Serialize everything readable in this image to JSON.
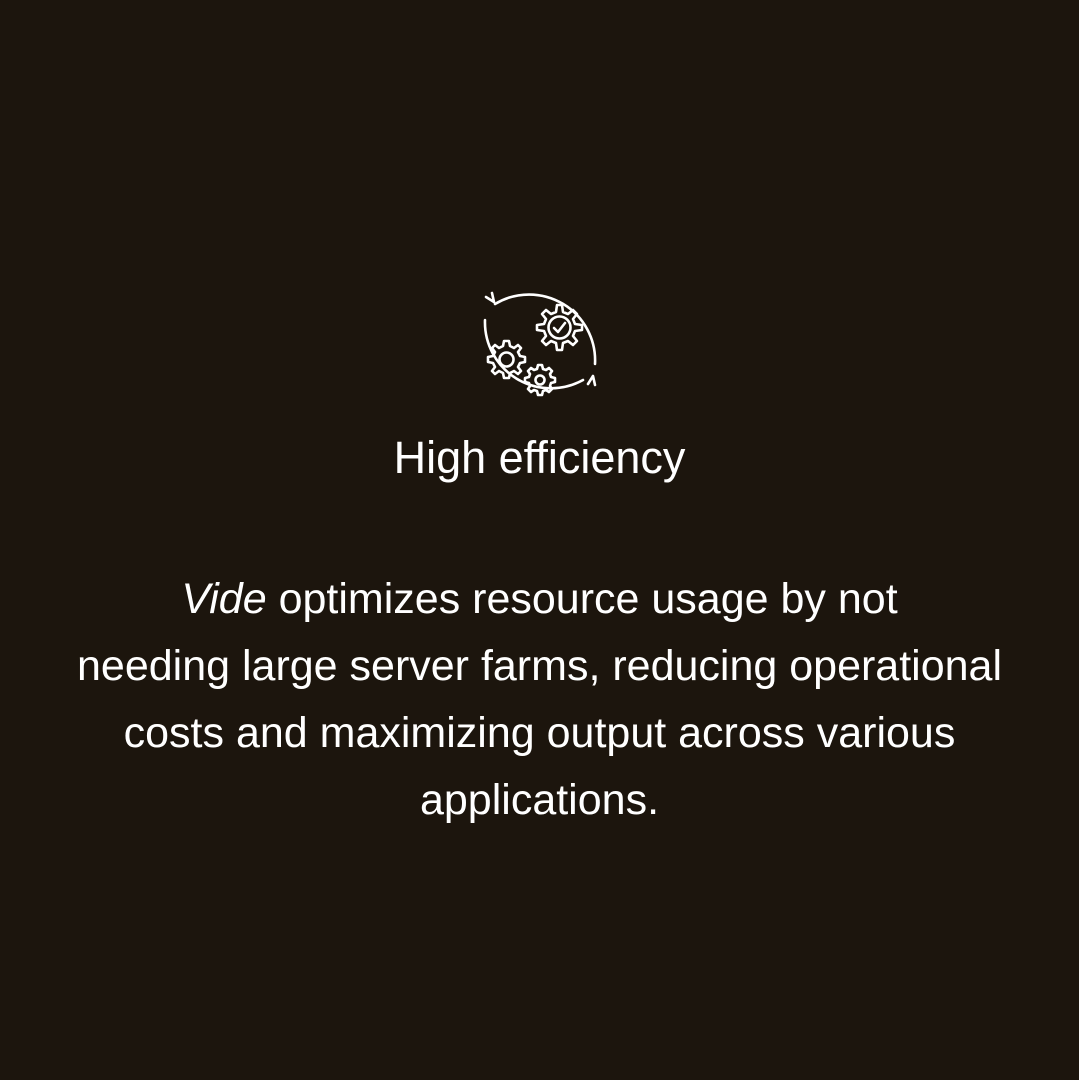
{
  "colors": {
    "background": "#1c150d",
    "foreground": "#ffffff"
  },
  "icon": {
    "name": "gears-check-cycle-icon"
  },
  "title": "High efficiency",
  "description": {
    "brand": "Vide",
    "line1_rest": " optimizes resource usage  by not",
    "line2": "needing large server farms, reducing operational",
    "line3": "costs and maximizing output across various",
    "line4": "applications."
  }
}
